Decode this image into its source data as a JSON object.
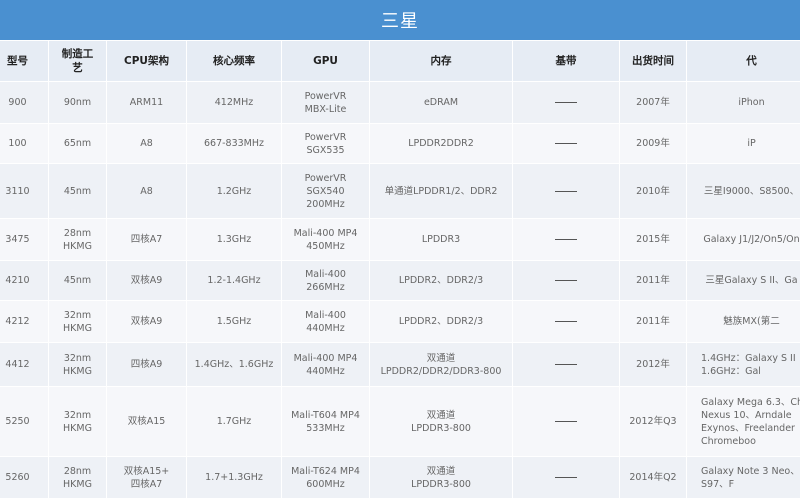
{
  "title": "三星",
  "headers": [
    "型号",
    "制造工艺",
    "CPU架构",
    "核心频率",
    "GPU",
    "内存",
    "基带",
    "出货时间",
    "代表机型"
  ],
  "header_visible": [
    "型号",
    "制造工\n艺",
    "CPU架构",
    "核心频率",
    "GPU",
    "内存",
    "基带",
    "出货时间",
    "代"
  ],
  "rows": [
    {
      "model": "900",
      "process": "90nm",
      "cpu": "ARM11",
      "freq": "412MHz",
      "gpu": "PowerVR\nMBX-Lite",
      "memory": "eDRAM",
      "baseband": "——",
      "date": "2007年",
      "devices": "iPhon"
    },
    {
      "model": "100",
      "process": "65nm",
      "cpu": "A8",
      "freq": "667-833MHz",
      "gpu": "PowerVR\nSGX535",
      "memory": "LPDDR2DDR2",
      "baseband": "——",
      "date": "2009年",
      "devices": "iP"
    },
    {
      "model": "3110",
      "process": "45nm",
      "cpu": "A8",
      "freq": "1.2GHz",
      "gpu": "PowerVR\nSGX540\n200MHz",
      "memory": "单通道LPDDR1/2、DDR2",
      "baseband": "——",
      "date": "2010年",
      "devices": "三星I9000、S8500、"
    },
    {
      "model": "3475",
      "process": "28nm\nHKMG",
      "cpu": "四核A7",
      "freq": "1.3GHz",
      "gpu": "Mali-400 MP4\n450MHz",
      "memory": "LPDDR3",
      "baseband": "——",
      "date": "2015年",
      "devices": "Galaxy J1/J2/On5/On"
    },
    {
      "model": "4210",
      "process": "45nm",
      "cpu": "双核A9",
      "freq": "1.2-1.4GHz",
      "gpu": "Mali-400\n266MHz",
      "memory": "LPDDR2、DDR2/3",
      "baseband": "——",
      "date": "2011年",
      "devices": "三星Galaxy S II、Ga"
    },
    {
      "model": "4212",
      "process": "32nm\nHKMG",
      "cpu": "双核A9",
      "freq": "1.5GHz",
      "gpu": "Mali-400\n440MHz",
      "memory": "LPDDR2、DDR2/3",
      "baseband": "——",
      "date": "2011年",
      "devices": "魅族MX(第二"
    },
    {
      "model": "4412",
      "process": "32nm\nHKMG",
      "cpu": "四核A9",
      "freq": "1.4GHz、1.6GHz",
      "gpu": "Mali-400 MP4\n440MHz",
      "memory": "双通道\nLPDDR2/DDR2/DDR3-800",
      "baseband": "——",
      "date": "2012年",
      "devices": "1.4GHz：Galaxy S II\n1.6GHz：Gal"
    },
    {
      "model": "5250",
      "process": "32nm\nHKMG",
      "cpu": "双核A15",
      "freq": "1.7GHz",
      "gpu": "Mali-T604 MP4\n533MHz",
      "memory": "双通道\nLPDDR3-800",
      "baseband": "——",
      "date": "2012年Q3",
      "devices": "Galaxy Mega 6.3、Ch\nNexus 10、Arndale\nExynos、Freelander\nChromeboo"
    },
    {
      "model": "5260",
      "process": "28nm\nHKMG",
      "cpu": "双核A15+\n四核A7",
      "freq": "1.7+1.3GHz",
      "gpu": "Mali-T624 MP4\n600MHz",
      "memory": "双通道\nLPDDR3-800",
      "baseband": "——",
      "date": "2014年Q2",
      "devices": "Galaxy Note 3 Neo、S\nS97、F"
    }
  ]
}
